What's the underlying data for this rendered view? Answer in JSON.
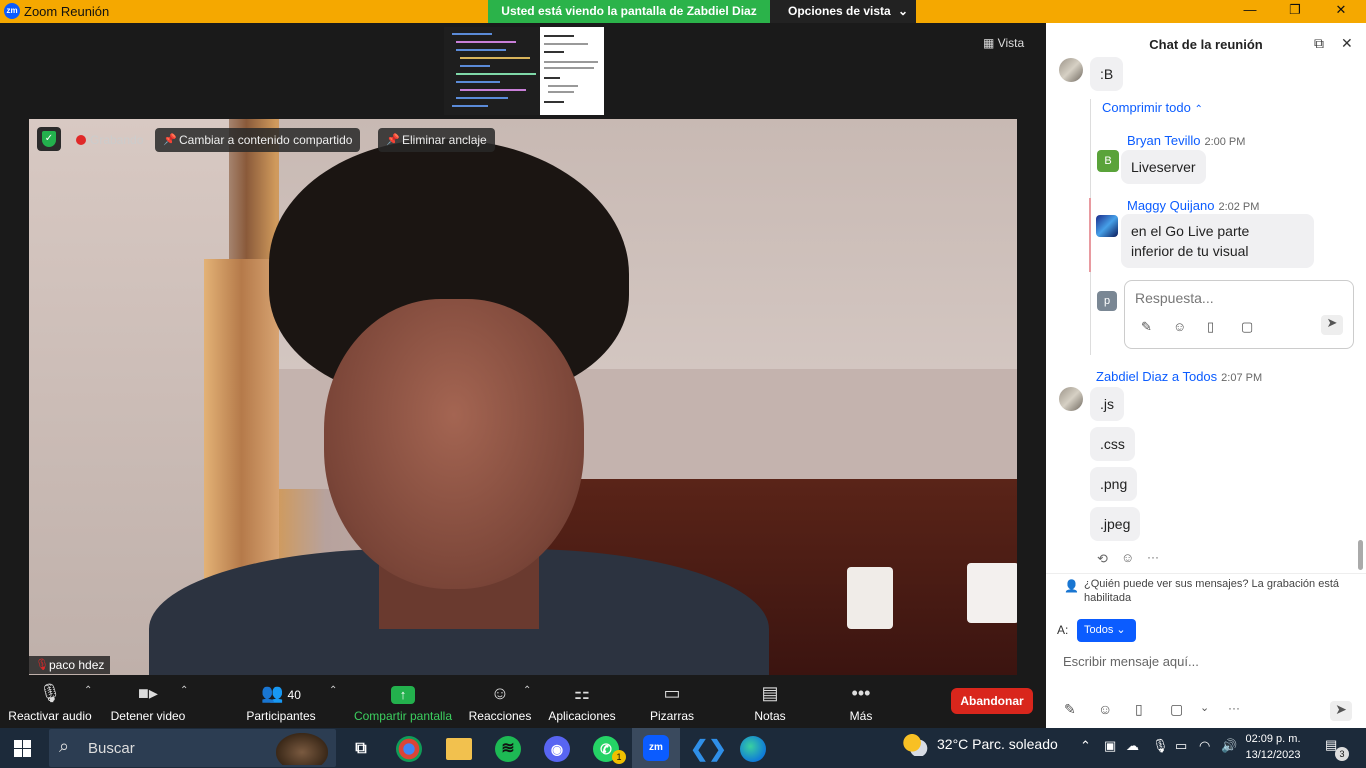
{
  "window": {
    "app_icon": "zm",
    "title": "Zoom Reunión",
    "share_banner": "Usted está viendo la pantalla de Zabdiel Diaz",
    "view_options": "Opciones de vista",
    "minimize": "—",
    "maximize": "❐",
    "close": "✕"
  },
  "video": {
    "view_label": "Vista",
    "recording": "Grabando",
    "switch_content": "Cambiar a contenido compartido",
    "unpin": "Eliminar anclaje",
    "participant_name": "paco hdez"
  },
  "toolbar": {
    "mute": "Reactivar audio",
    "video": "Detener video",
    "participants": "Participantes",
    "participants_count": "40",
    "share": "Compartir pantalla",
    "reactions": "Reacciones",
    "apps": "Aplicaciones",
    "whiteboards": "Pizarras",
    "notes": "Notas",
    "more": "Más",
    "leave": "Abandonar"
  },
  "chat": {
    "title": "Chat de la reunión",
    "top_message": ":B",
    "collapse_all": "Comprimir todo",
    "thread": [
      {
        "sender": "Bryan Tevillo",
        "time": "2:00 PM",
        "avatar_letter": "B",
        "avatar_color": "#5aa33a",
        "text": "Liveserver"
      },
      {
        "sender": "Maggy Quijano",
        "time": "2:02 PM",
        "text_line1": "en el Go Live parte",
        "text_line2": "inferior de tu visual"
      }
    ],
    "reply_avatar_letter": "p",
    "reply_placeholder": "Respuesta...",
    "last_sender": "Zabdiel Diaz a Todos",
    "last_time": "2:07 PM",
    "last_messages": [
      ".js",
      ".css",
      ".png",
      ".jpeg"
    ],
    "privacy_note": "¿Quién puede ver sus mensajes? La grabación está habilitada",
    "to_label": "A:",
    "to_value": "Todos",
    "input_placeholder": "Escribir mensaje aquí..."
  },
  "taskbar": {
    "search": "Buscar",
    "whatsapp_badge": "1",
    "weather": "32°C  Parc. soleado",
    "time": "02:09 p. m.",
    "date": "13/12/2023",
    "notifications": "3"
  },
  "colors": {
    "title_bar": "#f5a800",
    "zoom_blue": "#0b5cff",
    "share_green": "#2bb34a",
    "leave_red": "#d9261c"
  }
}
